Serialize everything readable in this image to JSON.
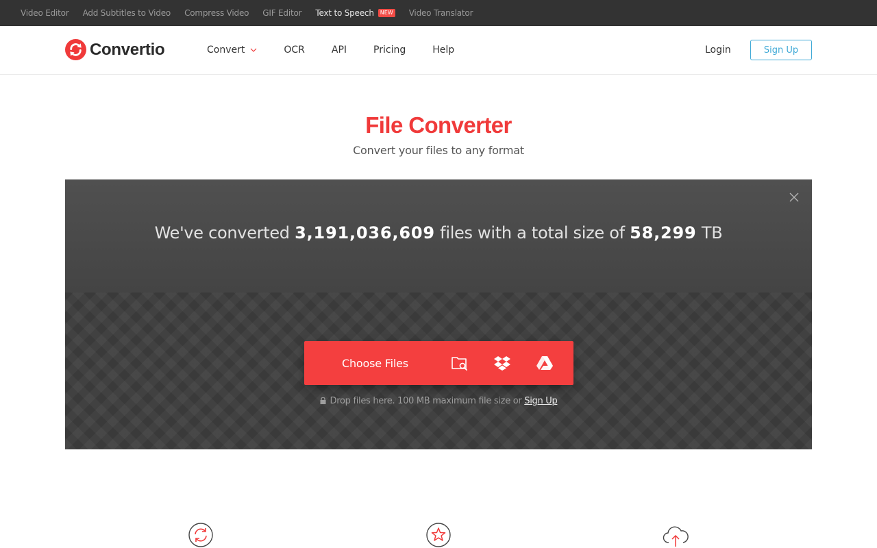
{
  "topbar": {
    "links": [
      "Video Editor",
      "Add Subtitles to Video",
      "Compress Video",
      "GIF Editor",
      "Text to Speech",
      "Video Translator"
    ],
    "new_badge": "NEW"
  },
  "header": {
    "logo_text": "Convertio",
    "nav": [
      "Convert",
      "OCR",
      "API",
      "Pricing",
      "Help"
    ],
    "login_label": "Login",
    "signup_label": "Sign Up"
  },
  "hero": {
    "title": "File Converter",
    "subtitle": "Convert your files to any format"
  },
  "panel": {
    "stats_prefix": "We've converted",
    "files_count": "3,191,036,609",
    "stats_middle": "files with a total size of",
    "total_size": "58,299",
    "size_unit": "TB",
    "choose_label": "Choose Files",
    "source_icons": [
      "folder-search-icon",
      "dropbox-icon",
      "google-drive-icon"
    ],
    "drop_note": "Drop files here. 100 MB maximum file size or",
    "drop_signup": "Sign Up"
  },
  "features": {
    "icons": [
      "refresh-icon",
      "star-icon",
      "cloud-upload-icon"
    ]
  },
  "colors": {
    "brand_red": "#f03a3a",
    "button_red": "#f43f3f",
    "signup_blue": "#3fa9d6",
    "topbar_bg": "#333333",
    "panel_bg": "#3a3a3a"
  }
}
